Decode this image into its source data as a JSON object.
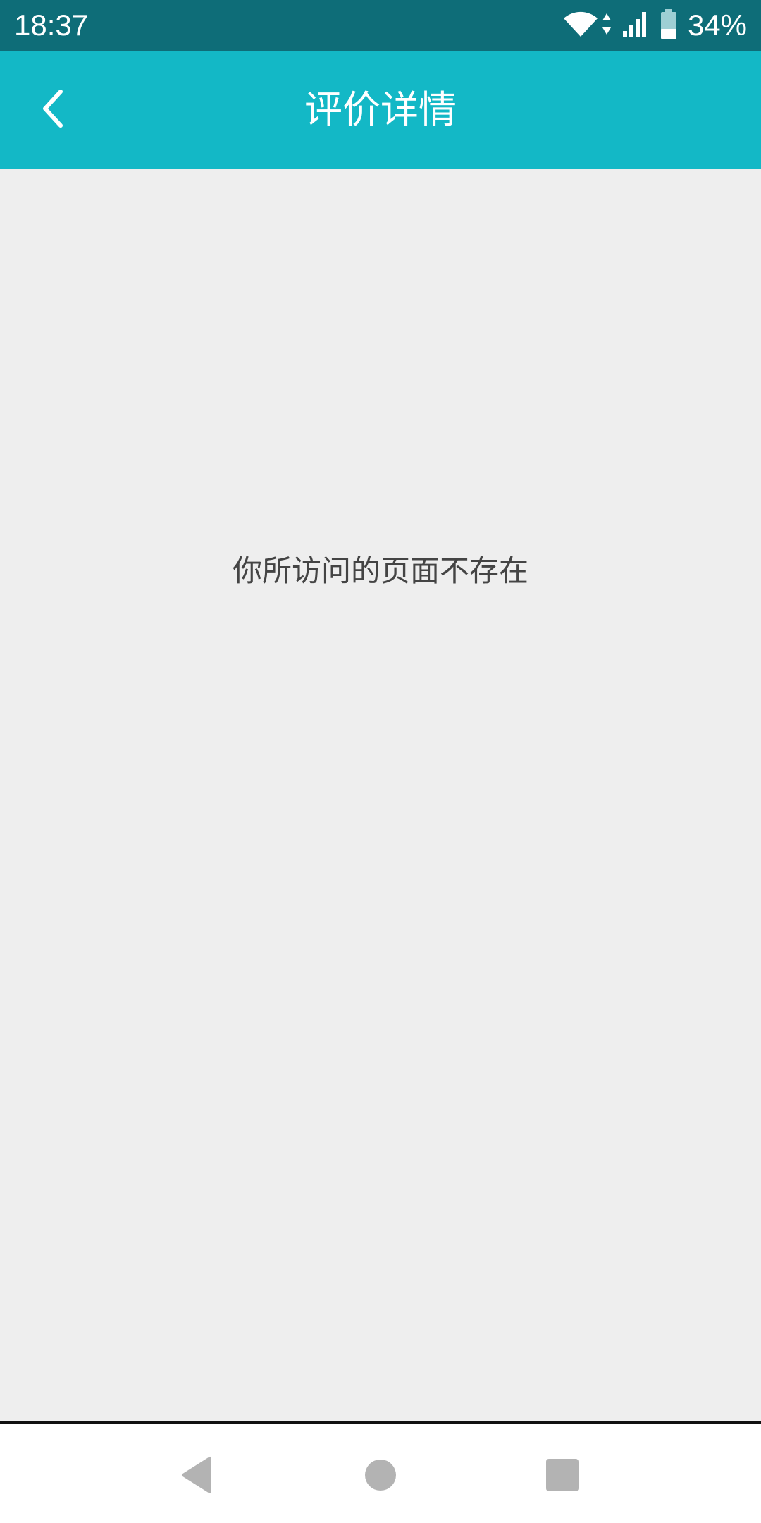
{
  "status_bar": {
    "time": "18:37",
    "battery_percent": "34%",
    "icons": [
      "wifi-icon",
      "data-arrows-icon",
      "cellular-signal-icon",
      "battery-icon"
    ]
  },
  "header": {
    "title": "评价详情",
    "back_icon": "chevron-left-icon"
  },
  "main": {
    "message": "你所访问的页面不存在"
  },
  "nav_bar": {
    "icons": [
      "nav-back-icon",
      "nav-home-icon",
      "nav-recents-icon"
    ]
  },
  "colors": {
    "status_bar": "#0e6d78",
    "app_bar": "#13b8c6",
    "background": "#eeeeee",
    "message_text": "#444444",
    "nav_icons": "#b3b3b3"
  }
}
